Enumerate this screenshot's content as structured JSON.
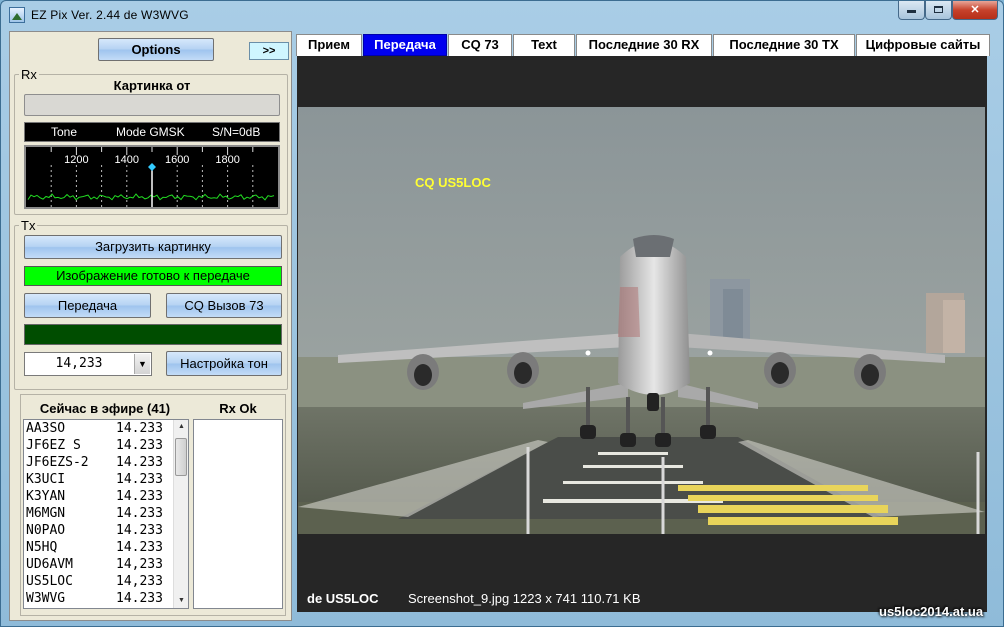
{
  "window": {
    "title": "EZ Pix    Ver. 2.44 de W3WVG"
  },
  "toolbar": {
    "options_label": "Options",
    "expand_label": ">>"
  },
  "rx": {
    "group_label": "Rx",
    "picture_from_label": "Картинка от",
    "sender_value": "",
    "status": {
      "tone": "Tone",
      "mode": "Mode GMSK",
      "snr": "S/N=0dB"
    },
    "waterfall": {
      "ticks": [
        "1200",
        "1400",
        "1600",
        "1800"
      ],
      "marker_hz": 1500,
      "range_hz": [
        1000,
        2000
      ]
    }
  },
  "tx": {
    "group_label": "Tx",
    "load_picture_label": "Загрузить картинку",
    "ready_status": "Изображение готово к передаче",
    "transmit_label": "Передача",
    "cq_label": "CQ   Вызов   73",
    "frequency_value": "14,233",
    "tune_label": "Настройка тон"
  },
  "on_air": {
    "title": "Сейчас в эфире (41)",
    "rx_ok_title": "Rx Ok",
    "stations": [
      {
        "call": "AA3SO",
        "freq": "14.233"
      },
      {
        "call": "JF6EZ S",
        "freq": "14.233"
      },
      {
        "call": "JF6EZS-2",
        "freq": "14.233"
      },
      {
        "call": "K3UCI",
        "freq": "14.233"
      },
      {
        "call": "K3YAN",
        "freq": "14.233"
      },
      {
        "call": "M6MGN",
        "freq": "14.233"
      },
      {
        "call": "N0PAO",
        "freq": "14.233"
      },
      {
        "call": "N5HQ",
        "freq": "14.233"
      },
      {
        "call": "UD6AVM",
        "freq": "14,233"
      },
      {
        "call": "US5LOC",
        "freq": "14,233"
      },
      {
        "call": "W3WVG",
        "freq": "14.233"
      }
    ]
  },
  "tabs": [
    {
      "label": "Прием",
      "active": false
    },
    {
      "label": "Передача",
      "active": true
    },
    {
      "label": "CQ  73",
      "active": false
    },
    {
      "label": "Text",
      "active": false
    },
    {
      "label": "Последние 30 RX",
      "active": false
    },
    {
      "label": "Последние 30 TX",
      "active": false
    },
    {
      "label": "Цифровые сайты",
      "active": false
    }
  ],
  "image_panel": {
    "overlay_text": "CQ US5LOC",
    "callsign": "de US5LOC",
    "file_info": "Screenshot_9.jpg  1223 x 741  110.71 KB"
  },
  "watermark": "us5loc2014.at.ua",
  "colors": {
    "active_tab": "#0000ee",
    "ready_status": "#00ff00",
    "progress_dark": "#004d00",
    "overlay_text": "#ffff33"
  }
}
